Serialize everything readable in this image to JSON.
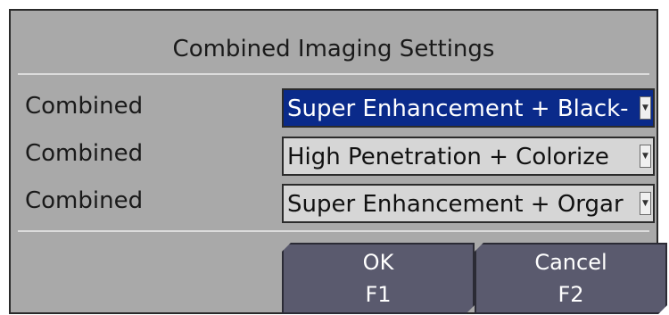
{
  "dialog": {
    "title": "Combined Imaging Settings",
    "rows": [
      {
        "label": "Combined",
        "value": "Super Enhancement + Black-",
        "active": true
      },
      {
        "label": "Combined",
        "value": "High Penetration + Colorize",
        "active": false
      },
      {
        "label": "Combined",
        "value": "Super Enhancement + Orgar",
        "active": false
      }
    ],
    "buttons": {
      "ok": {
        "label": "OK",
        "key": "F1"
      },
      "cancel": {
        "label": "Cancel",
        "key": "F2"
      }
    }
  },
  "icons": {
    "dropdown_arrow": "▼"
  },
  "colors": {
    "dialog_bg": "#a9a9a9",
    "selected_bg": "#0a2a8a",
    "button_bg": "#5a5a6e"
  }
}
